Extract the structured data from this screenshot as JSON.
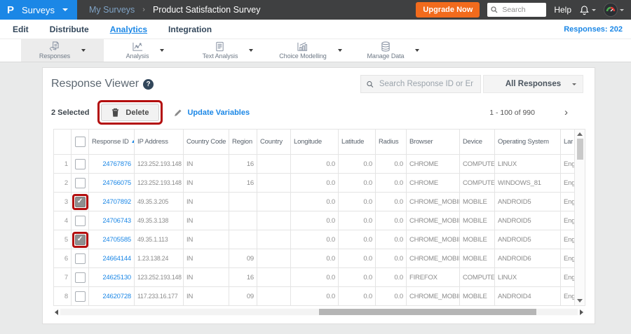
{
  "topbar": {
    "logo_text": "P",
    "product_menu": "Surveys",
    "breadcrumb": {
      "parent": "My Surveys",
      "separator": "›",
      "current": "Product Satisfaction Survey"
    },
    "upgrade_label": "Upgrade Now",
    "search_placeholder": "Search",
    "help_label": "Help"
  },
  "nav": {
    "items": [
      {
        "label": "Edit"
      },
      {
        "label": "Distribute"
      },
      {
        "label": "Analytics",
        "active": true
      },
      {
        "label": "Integration"
      }
    ],
    "responses_count": "Responses: 202"
  },
  "toolbar": {
    "items": [
      {
        "label": "Responses",
        "icon": "responses-icon",
        "active": true
      },
      {
        "label": "Analysis",
        "icon": "analysis-icon"
      },
      {
        "label": "Text Analysis",
        "icon": "text-analysis-icon"
      },
      {
        "label": "Choice Modelling",
        "icon": "choice-modelling-icon"
      },
      {
        "label": "Manage Data",
        "icon": "manage-data-icon"
      }
    ]
  },
  "viewer": {
    "title": "Response Viewer",
    "help_glyph": "?",
    "search_placeholder": "Search Response ID or Email",
    "filter_value": "All Responses",
    "selected_count": "2 Selected",
    "delete_label": "Delete",
    "update_variables_label": "Update Variables",
    "pagination": "1 - 100 of 990",
    "next_glyph": "›"
  },
  "table": {
    "headers": [
      "",
      "",
      "Response ID",
      "IP Address",
      "Country Code",
      "Region",
      "Country",
      "Longitude",
      "Latitude",
      "Radius",
      "Browser",
      "Device",
      "Operating System",
      "Lar"
    ],
    "sorted_column": "Response ID",
    "sort_direction": "asc",
    "rows": [
      {
        "num": "1",
        "checked": false,
        "highlight": false,
        "response_id": "24767876",
        "ip": "123.252.193.148",
        "country_code": "IN",
        "region": "16",
        "country": "",
        "longitude": "0.0",
        "latitude": "0.0",
        "radius": "0.0",
        "browser": "CHROME",
        "device": "COMPUTER",
        "os": "LINUX",
        "language": "Eng"
      },
      {
        "num": "2",
        "checked": false,
        "highlight": false,
        "response_id": "24766075",
        "ip": "123.252.193.148",
        "country_code": "IN",
        "region": "16",
        "country": "",
        "longitude": "0.0",
        "latitude": "0.0",
        "radius": "0.0",
        "browser": "CHROME",
        "device": "COMPUTER",
        "os": "WINDOWS_81",
        "language": "Eng"
      },
      {
        "num": "3",
        "checked": true,
        "highlight": true,
        "response_id": "24707892",
        "ip": "49.35.3.205",
        "country_code": "IN",
        "region": "",
        "country": "",
        "longitude": "0.0",
        "latitude": "0.0",
        "radius": "0.0",
        "browser": "CHROME_MOBILE",
        "device": "MOBILE",
        "os": "ANDROID5",
        "language": "Eng"
      },
      {
        "num": "4",
        "checked": false,
        "highlight": false,
        "response_id": "24706743",
        "ip": "49.35.3.138",
        "country_code": "IN",
        "region": "",
        "country": "",
        "longitude": "0.0",
        "latitude": "0.0",
        "radius": "0.0",
        "browser": "CHROME_MOBILE",
        "device": "MOBILE",
        "os": "ANDROID5",
        "language": "Eng"
      },
      {
        "num": "5",
        "checked": true,
        "highlight": true,
        "response_id": "24705585",
        "ip": "49.35.1.113",
        "country_code": "IN",
        "region": "",
        "country": "",
        "longitude": "0.0",
        "latitude": "0.0",
        "radius": "0.0",
        "browser": "CHROME_MOBILE",
        "device": "MOBILE",
        "os": "ANDROID5",
        "language": "Eng"
      },
      {
        "num": "6",
        "checked": false,
        "highlight": false,
        "response_id": "24664144",
        "ip": "1.23.138.24",
        "country_code": "IN",
        "region": "09",
        "country": "",
        "longitude": "0.0",
        "latitude": "0.0",
        "radius": "0.0",
        "browser": "CHROME_MOBILE",
        "device": "MOBILE",
        "os": "ANDROID6",
        "language": "Eng"
      },
      {
        "num": "7",
        "checked": false,
        "highlight": false,
        "response_id": "24625130",
        "ip": "123.252.193.148",
        "country_code": "IN",
        "region": "16",
        "country": "",
        "longitude": "0.0",
        "latitude": "0.0",
        "radius": "0.0",
        "browser": "FIREFOX",
        "device": "COMPUTER",
        "os": "LINUX",
        "language": "Eng"
      },
      {
        "num": "8",
        "checked": false,
        "highlight": false,
        "response_id": "24620728",
        "ip": "117.233.16.177",
        "country_code": "IN",
        "region": "09",
        "country": "",
        "longitude": "0.0",
        "latitude": "0.0",
        "radius": "0.0",
        "browser": "CHROME_MOBILE",
        "device": "MOBILE",
        "os": "ANDROID4",
        "language": "Eng"
      }
    ]
  },
  "colors": {
    "brand_blue": "#1b87e6",
    "topbar_dark": "#3f4041",
    "upgrade_orange": "#f26b1d",
    "annotation_red": "#b30e0e",
    "link_blue": "#1b87e6"
  }
}
